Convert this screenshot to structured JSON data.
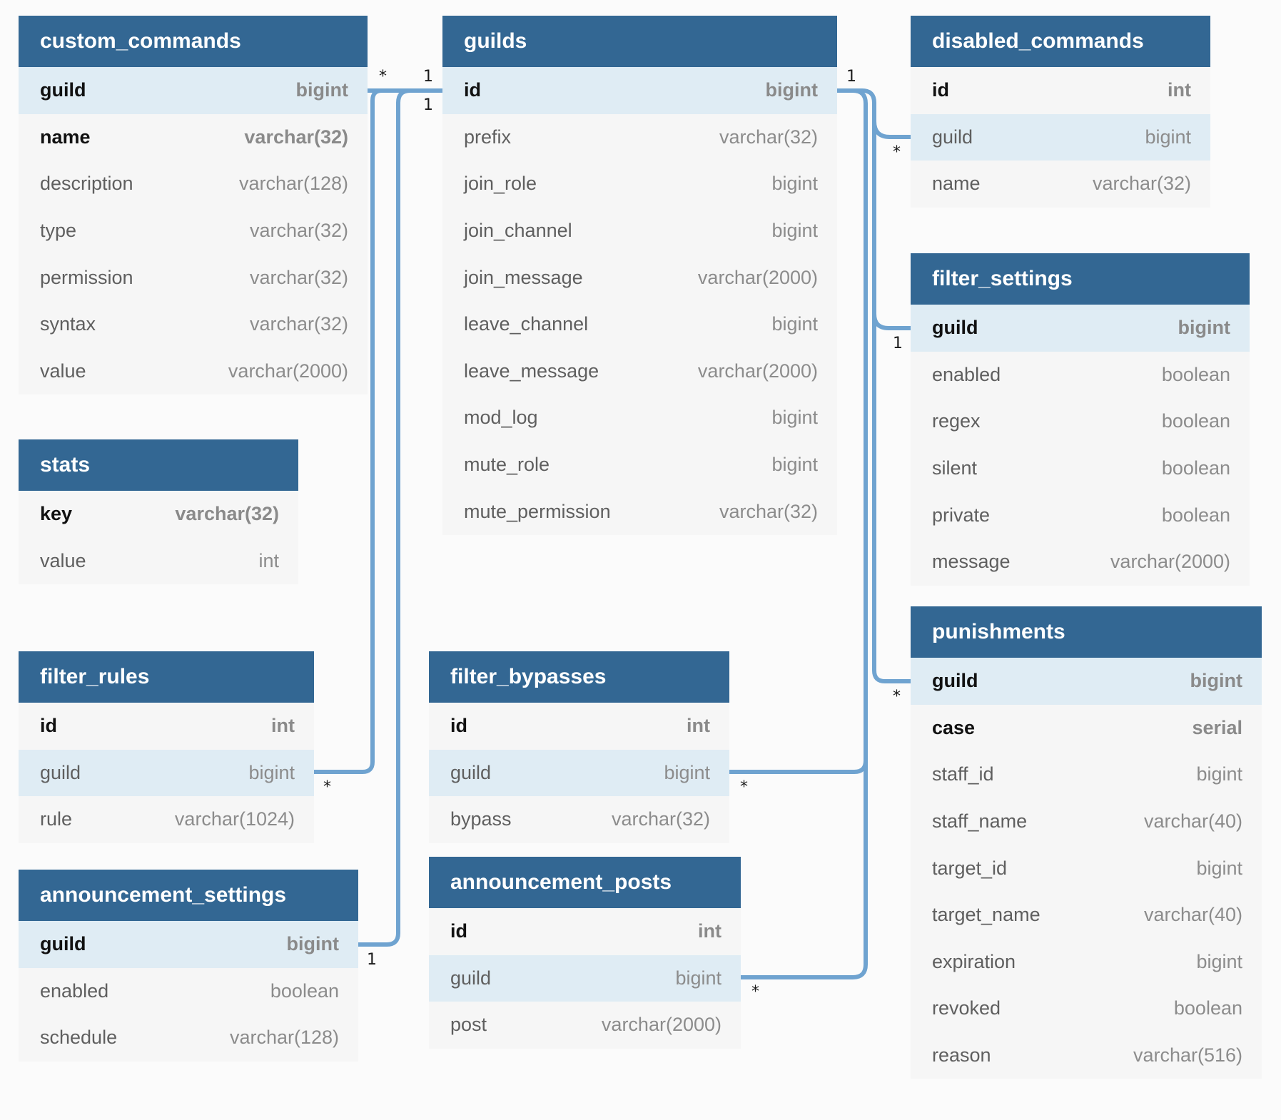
{
  "diagram": {
    "tables": [
      {
        "name": "custom_commands",
        "columns": [
          {
            "name": "guild",
            "type": "bigint",
            "key": true,
            "highlight": true
          },
          {
            "name": "name",
            "type": "varchar(32)",
            "key": true
          },
          {
            "name": "description",
            "type": "varchar(128)"
          },
          {
            "name": "type",
            "type": "varchar(32)"
          },
          {
            "name": "permission",
            "type": "varchar(32)"
          },
          {
            "name": "syntax",
            "type": "varchar(32)"
          },
          {
            "name": "value",
            "type": "varchar(2000)"
          }
        ]
      },
      {
        "name": "guilds",
        "columns": [
          {
            "name": "id",
            "type": "bigint",
            "key": true,
            "highlight": true
          },
          {
            "name": "prefix",
            "type": "varchar(32)"
          },
          {
            "name": "join_role",
            "type": "bigint"
          },
          {
            "name": "join_channel",
            "type": "bigint"
          },
          {
            "name": "join_message",
            "type": "varchar(2000)"
          },
          {
            "name": "leave_channel",
            "type": "bigint"
          },
          {
            "name": "leave_message",
            "type": "varchar(2000)"
          },
          {
            "name": "mod_log",
            "type": "bigint"
          },
          {
            "name": "mute_role",
            "type": "bigint"
          },
          {
            "name": "mute_permission",
            "type": "varchar(32)"
          }
        ]
      },
      {
        "name": "disabled_commands",
        "columns": [
          {
            "name": "id",
            "type": "int",
            "key": true
          },
          {
            "name": "guild",
            "type": "bigint",
            "highlight": true
          },
          {
            "name": "name",
            "type": "varchar(32)"
          }
        ]
      },
      {
        "name": "stats",
        "columns": [
          {
            "name": "key",
            "type": "varchar(32)",
            "key": true
          },
          {
            "name": "value",
            "type": "int"
          }
        ]
      },
      {
        "name": "filter_settings",
        "columns": [
          {
            "name": "guild",
            "type": "bigint",
            "key": true,
            "highlight": true
          },
          {
            "name": "enabled",
            "type": "boolean"
          },
          {
            "name": "regex",
            "type": "boolean"
          },
          {
            "name": "silent",
            "type": "boolean"
          },
          {
            "name": "private",
            "type": "boolean"
          },
          {
            "name": "message",
            "type": "varchar(2000)"
          }
        ]
      },
      {
        "name": "punishments",
        "columns": [
          {
            "name": "guild",
            "type": "bigint",
            "key": true,
            "highlight": true
          },
          {
            "name": "case",
            "type": "serial",
            "key": true
          },
          {
            "name": "staff_id",
            "type": "bigint"
          },
          {
            "name": "staff_name",
            "type": "varchar(40)"
          },
          {
            "name": "target_id",
            "type": "bigint"
          },
          {
            "name": "target_name",
            "type": "varchar(40)"
          },
          {
            "name": "expiration",
            "type": "bigint"
          },
          {
            "name": "revoked",
            "type": "boolean"
          },
          {
            "name": "reason",
            "type": "varchar(516)"
          }
        ]
      },
      {
        "name": "filter_rules",
        "columns": [
          {
            "name": "id",
            "type": "int",
            "key": true
          },
          {
            "name": "guild",
            "type": "bigint",
            "highlight": true
          },
          {
            "name": "rule",
            "type": "varchar(1024)"
          }
        ]
      },
      {
        "name": "filter_bypasses",
        "columns": [
          {
            "name": "id",
            "type": "int",
            "key": true
          },
          {
            "name": "guild",
            "type": "bigint",
            "highlight": true
          },
          {
            "name": "bypass",
            "type": "varchar(32)"
          }
        ]
      },
      {
        "name": "announcement_settings",
        "columns": [
          {
            "name": "guild",
            "type": "bigint",
            "key": true,
            "highlight": true
          },
          {
            "name": "enabled",
            "type": "boolean"
          },
          {
            "name": "schedule",
            "type": "varchar(128)"
          }
        ]
      },
      {
        "name": "announcement_posts",
        "columns": [
          {
            "name": "id",
            "type": "int",
            "key": true
          },
          {
            "name": "guild",
            "type": "bigint",
            "highlight": true
          },
          {
            "name": "post",
            "type": "varchar(2000)"
          }
        ]
      }
    ],
    "relationships": [
      {
        "from": "custom_commands.guild",
        "to": "guilds.id",
        "from_card": "*",
        "to_card": "1"
      },
      {
        "from": "filter_rules.guild",
        "to": "guilds.id",
        "from_card": "*",
        "to_card": "1"
      },
      {
        "from": "announcement_settings.guild",
        "to": "guilds.id",
        "from_card": "1",
        "to_card": "1"
      },
      {
        "from": "disabled_commands.guild",
        "to": "guilds.id",
        "from_card": "*",
        "to_card": "1"
      },
      {
        "from": "filter_settings.guild",
        "to": "guilds.id",
        "from_card": "1",
        "to_card": "1"
      },
      {
        "from": "punishments.guild",
        "to": "guilds.id",
        "from_card": "*",
        "to_card": "1"
      },
      {
        "from": "filter_bypasses.guild",
        "to": "guilds.id",
        "from_card": "*",
        "to_card": "1"
      },
      {
        "from": "announcement_posts.guild",
        "to": "guilds.id",
        "from_card": "*",
        "to_card": "1"
      }
    ],
    "colors": {
      "header": "#336793",
      "row": "#f6f6f6",
      "highlight_row": "#dfecf4",
      "connector": "#6fa3d0",
      "background": "#fbfbfb"
    }
  }
}
